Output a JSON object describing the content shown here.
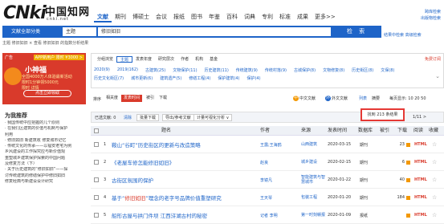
{
  "logo": {
    "main": "CNki",
    "cn": "中国知网",
    "sub": "cnki.net"
  },
  "nav": [
    "文献",
    "期刊",
    "博硕士",
    "会议",
    "报纸",
    "图书",
    "年鉴",
    "百科",
    "词典",
    "专利",
    "标准",
    "成果",
    "更多>>"
  ],
  "top_right": [
    "跨库检索",
    "出版物检索",
    "结果中检索  高级检索"
  ],
  "search": {
    "field": "文献全部分类",
    "scope": "主题",
    "query": "修旧如旧",
    "button": "检 索"
  },
  "side_links": "结果中检索  高级检索",
  "subnote": "主题 修旧如旧 ×    查看 修旧如旧 的指数分析结果",
  "ad": {
    "badge": "广告",
    "top": "APP新用户 限时 ¥3000 >",
    "title": "小神福",
    "line1": "全国4000万人体验最新活动",
    "line2": "限时1分钟领5000元",
    "line3": "限时 详情",
    "button": "点击立即领取"
  },
  "recommend": {
    "title": "为我推荐",
    "items": [
      "· 我国传统中应把握的几个原则",
      "· 在我们区建筑的价值与机制与保护",
      "  利用",
      "· 修旧如旧 新建筑收 修复城市记忆",
      "· 传统文化的传承——以福安老宅为例",
      "  乡风建设的工作探究应与新价值观",
      "  重塑城乡建筑保护探索的中国问题",
      "  及修复方法（下）",
      "· 关于历史建筑的“修旧如旧”——探",
      "  讨传统建筑的修缮保护中修旧如旧",
      "  修复经典与新建设设计研究"
    ]
  },
  "facets": {
    "tabs": [
      "分组浏览",
      "主题",
      "发表年度",
      "研究层次",
      "作者",
      "机构",
      "基金"
    ],
    "clear": "免费订阅",
    "row1": [
      "2020(9)",
      "2019(162)",
      "古建筑(25)",
      "文物保护(11)",
      "历史建筑(11)",
      "传统建筑(9)",
      "传统村落(9)",
      "古城保护(8)",
      "文物修复(8)",
      "历史街区(8)",
      "文保(8)"
    ],
    "row2": [
      "历史文化街区(7)",
      "城市更新(6)",
      "建筑遗产(5)",
      "修缮工程(4)",
      "保护建筑(4)",
      "保护(4)"
    ]
  },
  "sort": {
    "label": "排序",
    "options": [
      "相关度",
      "发表时间",
      "被引",
      "下载"
    ],
    "active": 1,
    "lang": "中文文献",
    "foreign": "外文文献",
    "list": "列表",
    "abstract": "摘要",
    "per_page": "每页显示: 10  20  50"
  },
  "toolbar": {
    "selected": "已选文献: 0",
    "clear": "清除",
    "batch": "批量下载",
    "export": "导出/参考文献",
    "visual": "计量可视化分析 ∨",
    "found": "找到 213 条结果",
    "pager": "1/11  >"
  },
  "table": {
    "headers": [
      "题名",
      "作者",
      "来源",
      "发表时间",
      "数据库",
      "被引",
      "下载",
      "阅读",
      "收藏"
    ],
    "rows": [
      {
        "num": "1",
        "title_pre": "鞍山“谷町”历史街区的更新与改造策略",
        "title_hl": "",
        "title_post": "",
        "author": "王露;王海鸥",
        "source": "山西建筑",
        "date": "2020-03-15",
        "db": "期刊",
        "cited": "",
        "downloads": "23",
        "read": "HTML"
      },
      {
        "num": "2",
        "title_pre": "《老屋车修怎能修旧如旧》",
        "title_hl": "",
        "title_post": "",
        "author": "赵良",
        "source": "城乡建设",
        "date": "2020-02-15",
        "db": "期刊",
        "cited": "",
        "downloads": "6",
        "read": "HTML"
      },
      {
        "num": "3",
        "title_pre": "古街区氛围的保护",
        "title_hl": "",
        "title_post": "",
        "author": "李镜凡",
        "source": "智能建筑与智慧城市",
        "date": "2020-01-22",
        "db": "期刊",
        "cited": "",
        "downloads": "40",
        "read": "HTML"
      },
      {
        "num": "4",
        "title_pre": "基于“",
        "title_hl": "修旧如旧",
        "title_post": "”理念的老字号品牌价值重塑研究",
        "author": "王天琴",
        "source": "包装工程",
        "date": "2020-01-20",
        "db": "期刊",
        "cited": "",
        "downloads": "184",
        "read": "HTML"
      },
      {
        "num": "5",
        "title_pre": "船形古屋与拱门件坝 江西浒湖古村的秘密",
        "title_hl": "",
        "title_post": "",
        "author": "记者 李明",
        "source": "第一时刻赣报",
        "date": "2020-01-09",
        "db": "报纸",
        "cited": "",
        "downloads": "",
        "read": "HTML"
      }
    ]
  },
  "colors": {
    "brand": "#1e64c8",
    "accent": "#d93a2b",
    "highlight_box": "#e53935"
  }
}
